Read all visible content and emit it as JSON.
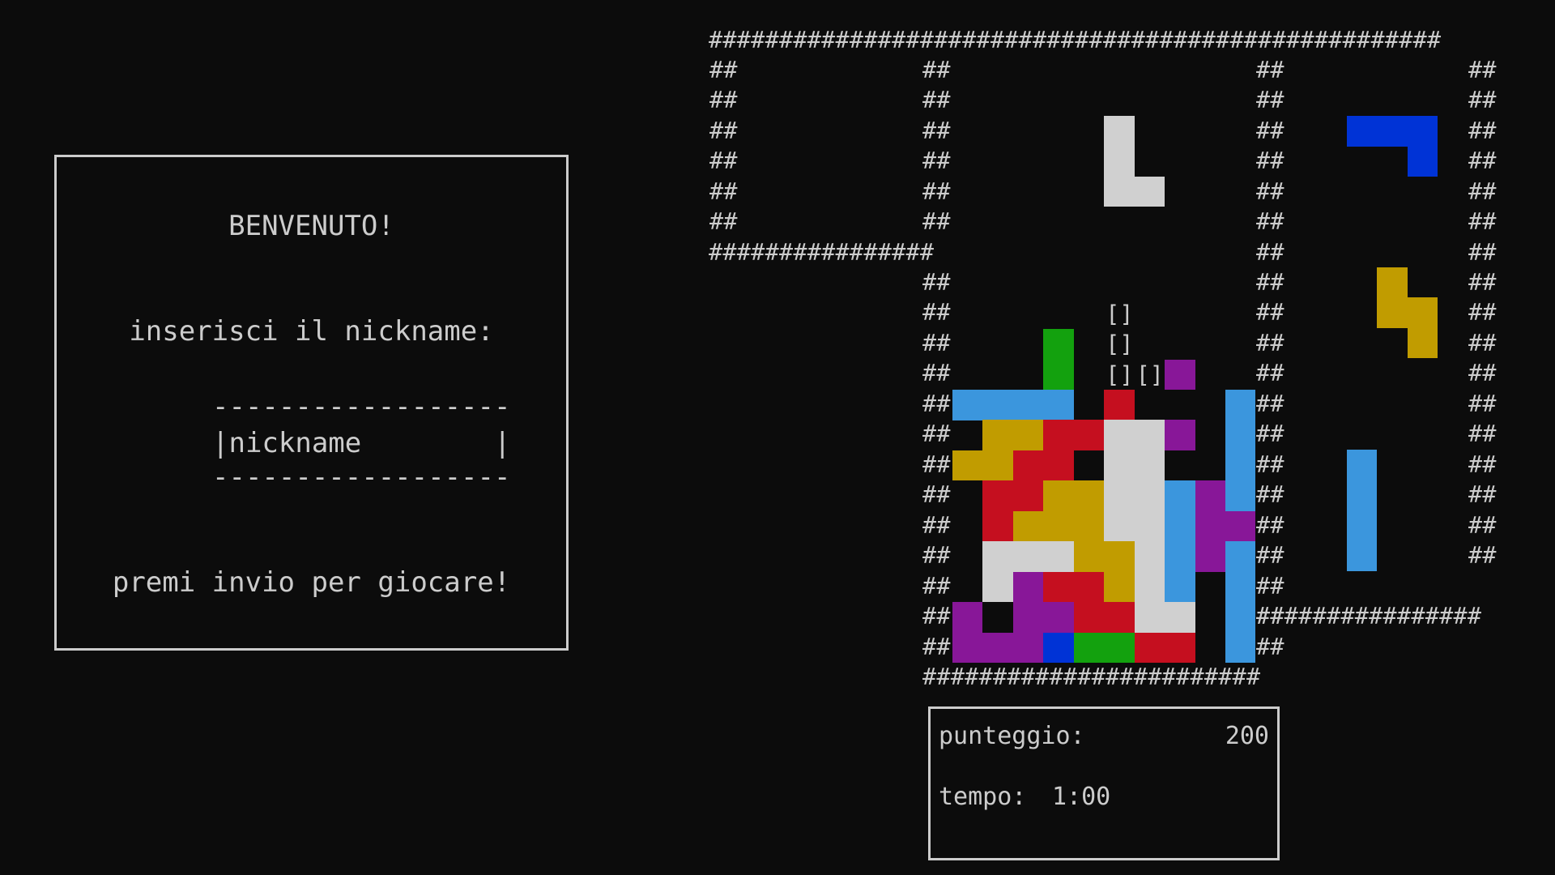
{
  "welcome": {
    "title": "BENVENUTO!",
    "prompt": "inserisci il nickname:",
    "input_top_border": "------------------",
    "input_placeholder": "|nickname        |",
    "input_bottom_border": "------------------",
    "start_hint": "premi invio per giocare!"
  },
  "board": {
    "wall_glyph": "##",
    "floor_glyph": "#",
    "ghost_glyph": "[]",
    "palette": {
      "W": "#d0d0d0",
      "B": "#0033d6",
      "Y": "#c19c00",
      "G": "#13a10e",
      "R": "#c50f1f",
      "P": "#881798",
      "C": "#3b96dd"
    },
    "stack_rows": [
      "C C C C . R . . . C",
      ". Y Y R R W W P . C",
      "Y Y R R . W W . . C",
      ". R R Y Y W W C P C",
      ". R Y Y Y W W C P P",
      ". W W W Y Y W C P C",
      ". W P R R Y W C . C",
      "P . P P R R W W . C",
      "P P P B G G R R . C"
    ],
    "falling_piece": {
      "type": "L",
      "color": "W"
    },
    "green_column": {
      "color": "G"
    }
  },
  "previews": {
    "hold": {
      "label": "",
      "pieces": []
    },
    "next": [
      {
        "type": "J",
        "color": "B"
      },
      {
        "type": "Z",
        "color": "Y"
      },
      {
        "type": "I",
        "color": "C"
      }
    ]
  },
  "stats": {
    "score_label": "punteggio:",
    "score_value": "200",
    "time_label": "tempo:",
    "time_value": "1:00"
  }
}
